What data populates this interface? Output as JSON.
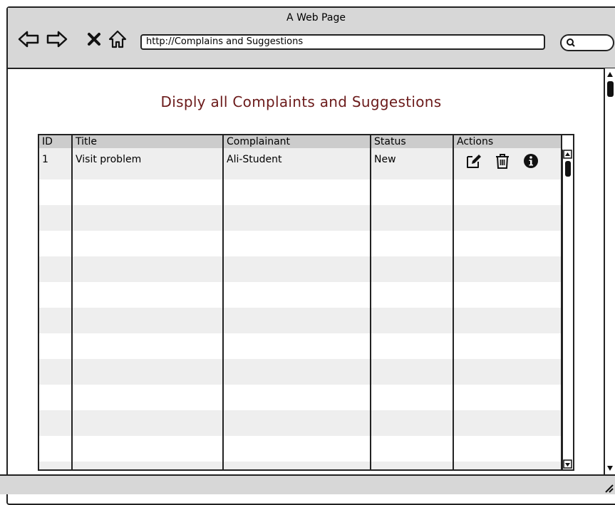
{
  "window": {
    "title": "A Web Page"
  },
  "browser": {
    "url": "http://Complains and Suggestions"
  },
  "page": {
    "heading": "Disply all Complaints and Suggestions"
  },
  "table": {
    "headers": {
      "id": "ID",
      "title": "Title",
      "complainant": "Complainant",
      "status": "Status",
      "actions": "Actions"
    },
    "rows": [
      {
        "id": "1",
        "title": "Visit problem",
        "complainant": "Ali-Student",
        "status": "New"
      }
    ],
    "action_icons": [
      "edit-icon",
      "trash-icon",
      "info-icon"
    ]
  }
}
